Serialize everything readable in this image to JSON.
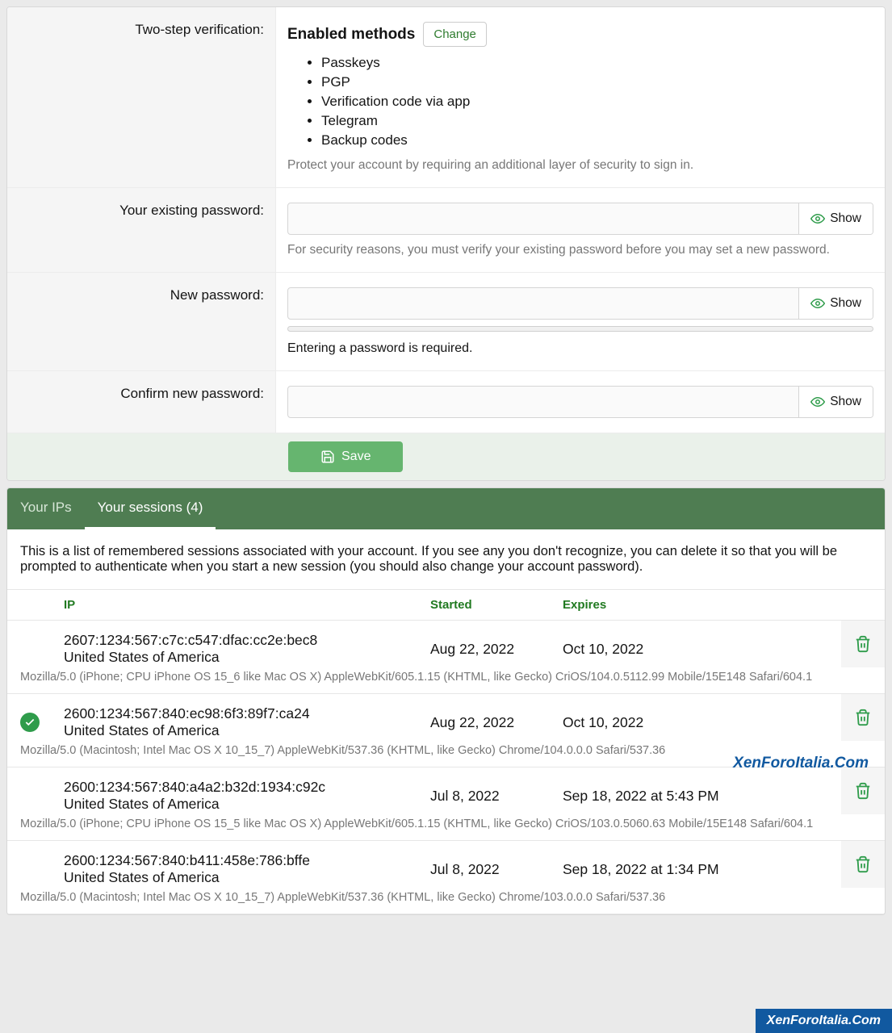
{
  "twoStep": {
    "label": "Two-step verification:",
    "heading": "Enabled methods",
    "changeBtn": "Change",
    "methods": [
      "Passkeys",
      "PGP",
      "Verification code via app",
      "Telegram",
      "Backup codes"
    ],
    "hint": "Protect your account by requiring an additional layer of security to sign in."
  },
  "passwords": {
    "existingLabel": "Your existing password:",
    "existingHint": "For security reasons, you must verify your existing password before you may set a new password.",
    "newLabel": "New password:",
    "newWarn": "Entering a password is required.",
    "confirmLabel": "Confirm new password:",
    "showLabel": "Show"
  },
  "saveBtn": "Save",
  "tabs": {
    "ips": "Your IPs",
    "sessions": "Your sessions (4)"
  },
  "sessionsDesc": "This is a list of remembered sessions associated with your account. If you see any you don't recognize, you can delete it so that you will be prompted to authenticate when you start a new session (you should also change your account password).",
  "headers": {
    "ip": "IP",
    "started": "Started",
    "expires": "Expires"
  },
  "sessions": [
    {
      "current": false,
      "ip": "2607:1234:567:c7c:c547:dfac:cc2e:bec8",
      "location": "United States of America",
      "started": "Aug 22, 2022",
      "expires": "Oct 10, 2022",
      "ua": "Mozilla/5.0 (iPhone; CPU iPhone OS 15_6 like Mac OS X) AppleWebKit/605.1.15 (KHTML, like Gecko) CriOS/104.0.5112.99 Mobile/15E148 Safari/604.1"
    },
    {
      "current": true,
      "ip": "2600:1234:567:840:ec98:6f3:89f7:ca24",
      "location": "United States of America",
      "started": "Aug 22, 2022",
      "expires": "Oct 10, 2022",
      "ua": "Mozilla/5.0 (Macintosh; Intel Mac OS X 10_15_7) AppleWebKit/537.36 (KHTML, like Gecko) Chrome/104.0.0.0 Safari/537.36"
    },
    {
      "current": false,
      "ip": "2600:1234:567:840:a4a2:b32d:1934:c92c",
      "location": "United States of America",
      "started": "Jul 8, 2022",
      "expires": "Sep 18, 2022 at 5:43 PM",
      "ua": "Mozilla/5.0 (iPhone; CPU iPhone OS 15_5 like Mac OS X) AppleWebKit/605.1.15 (KHTML, like Gecko) CriOS/103.0.5060.63 Mobile/15E148 Safari/604.1"
    },
    {
      "current": false,
      "ip": "2600:1234:567:840:b411:458e:786:bffe",
      "location": "United States of America",
      "started": "Jul 8, 2022",
      "expires": "Sep 18, 2022 at 1:34 PM",
      "ua": "Mozilla/5.0 (Macintosh; Intel Mac OS X 10_15_7) AppleWebKit/537.36 (KHTML, like Gecko) Chrome/103.0.0.0 Safari/537.36"
    }
  ],
  "watermark": "XenForoItalia.Com"
}
